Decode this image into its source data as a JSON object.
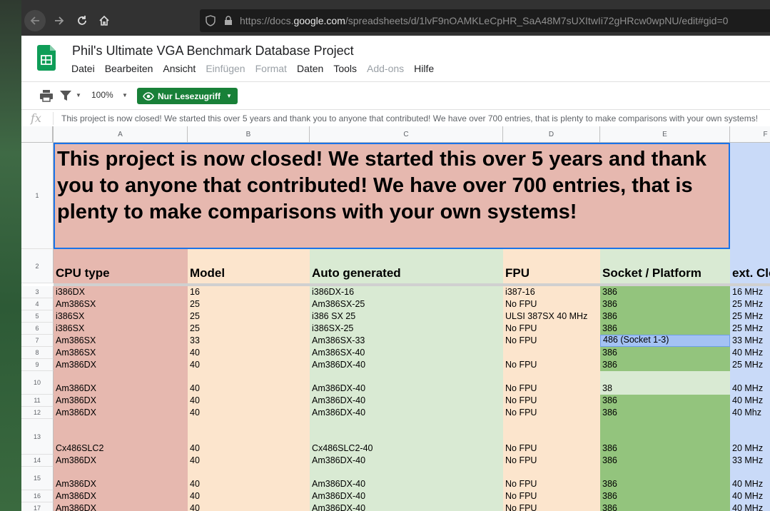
{
  "browser": {
    "url_prefix": "https://docs.",
    "url_domain": "google.com",
    "url_suffix": "/spreadsheets/d/1lvF9nOAMKLeCpHR_SaA48M7sUXItwIi72gHRcw0wpNU/edit#gid=0"
  },
  "doc": {
    "title": "Phil's Ultimate VGA Benchmark Database Project"
  },
  "menu": {
    "items": [
      {
        "label": "Datei",
        "disabled": false
      },
      {
        "label": "Bearbeiten",
        "disabled": false
      },
      {
        "label": "Ansicht",
        "disabled": false
      },
      {
        "label": "Einfügen",
        "disabled": true
      },
      {
        "label": "Format",
        "disabled": true
      },
      {
        "label": "Daten",
        "disabled": false
      },
      {
        "label": "Tools",
        "disabled": false
      },
      {
        "label": "Add-ons",
        "disabled": true
      },
      {
        "label": "Hilfe",
        "disabled": false
      }
    ]
  },
  "toolbar": {
    "zoom": "100%",
    "readonly_label": "Nur Lesezugriff",
    "print_icon": "print-icon",
    "filter_icon": "filter-icon"
  },
  "formula": {
    "fx": "fx",
    "text": "This project is now closed! We started this over 5 years and thank you to anyone that contributed! We have over 700 entries, that is plenty to make comparisons with your own systems!"
  },
  "columns": [
    "A",
    "B",
    "C",
    "D",
    "E",
    "F"
  ],
  "banner": {
    "row": "1",
    "text": "This project is now closed! We started this over 5 years and thank you to anyone that contributed! We have over 700 entries, that is plenty to make comparisons with your own systems!"
  },
  "headers": {
    "row": "2",
    "cells": [
      "CPU type",
      "Model",
      "Auto generated",
      "FPU",
      "Socket / Platform",
      "ext. Clock"
    ]
  },
  "rows": [
    {
      "num": "3",
      "cells": [
        "i386DX",
        "16",
        "i386DX-16",
        "i387-16",
        "386",
        "16 MHz"
      ]
    },
    {
      "num": "4",
      "cells": [
        "Am386SX",
        "25",
        "Am386SX-25",
        "No FPU",
        "386",
        "25 MHz"
      ]
    },
    {
      "num": "5",
      "cells": [
        "i386SX",
        "25",
        "i386 SX 25",
        "ULSI 387SX 40 MHz",
        "386",
        "25 MHz"
      ]
    },
    {
      "num": "6",
      "cells": [
        "i386SX",
        "25",
        "i386SX-25",
        "No FPU",
        "386",
        "25 MHz"
      ]
    },
    {
      "num": "7",
      "cells": [
        "Am386SX",
        "33",
        "Am386SX-33",
        "No FPU",
        "486 (Socket 1-3)",
        "33 MHz"
      ]
    },
    {
      "num": "8",
      "cells": [
        "Am386SX",
        "40",
        "Am386SX-40",
        "",
        "386",
        "40 MHz"
      ]
    },
    {
      "num": "9",
      "cells": [
        "Am386DX",
        "40",
        "Am386DX-40",
        "No FPU",
        "386",
        "25 MHz"
      ]
    },
    {
      "num": "10",
      "cells": [
        "Am386DX",
        "40",
        "Am386DX-40",
        "No FPU",
        "38",
        "40 MHz"
      ]
    },
    {
      "num": "11",
      "cells": [
        "Am386DX",
        "40",
        "Am386DX-40",
        "No FPU",
        "386",
        "40 MHz"
      ]
    },
    {
      "num": "12",
      "cells": [
        "Am386DX",
        "40",
        "Am386DX-40",
        "No FPU",
        "386",
        "40 Mhz"
      ]
    },
    {
      "num": "13",
      "cells": [
        "Cx486SLC2",
        "40",
        "Cx486SLC2-40",
        "No FPU",
        "386",
        "20 MHz"
      ]
    },
    {
      "num": "14",
      "cells": [
        "Am386DX",
        "40",
        "Am386DX-40",
        "No FPU",
        "386",
        "33 MHz"
      ]
    },
    {
      "num": "15",
      "cells": [
        "Am386DX",
        "40",
        "Am386DX-40",
        "No FPU",
        "386",
        "40 MHz"
      ]
    },
    {
      "num": "16",
      "cells": [
        "Am386DX",
        "40",
        "Am386DX-40",
        "No FPU",
        "386",
        "40 MHz"
      ]
    },
    {
      "num": "17",
      "cells": [
        "Am386DX",
        "40",
        "Am386DX-40",
        "No FPU",
        "386",
        "40 MHz"
      ]
    }
  ],
  "colors": {
    "col_a": "#e6b8af",
    "col_b": "#fce5cd",
    "col_c": "#d9ead3",
    "col_d": "#fce5cd",
    "col_e_green": "#93c47d",
    "col_e_light": "#d9ead3",
    "col_e_blue": "#a4c2f4",
    "col_f": "#c9daf8",
    "readonly_green": "#188038",
    "selection_blue": "#1a73e8"
  }
}
